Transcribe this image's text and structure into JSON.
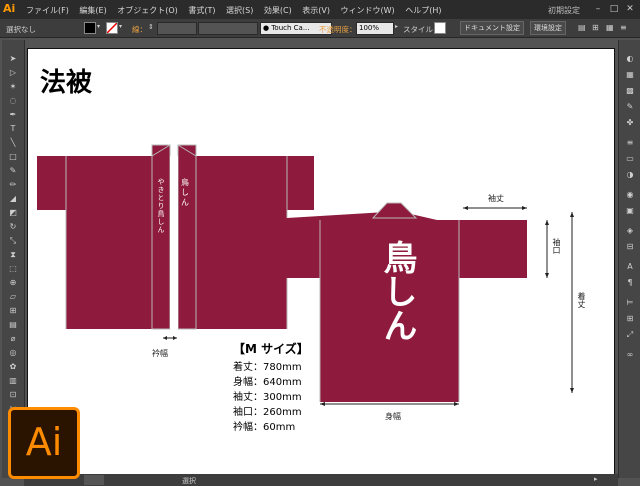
{
  "app": {
    "logo": "Ai",
    "menu": [
      "ファイル(F)",
      "編集(E)",
      "オブジェクト(O)",
      "書式(T)",
      "選択(S)",
      "効果(C)",
      "表示(V)",
      "ウィンドウ(W)",
      "ヘルプ(H)"
    ],
    "workspace": "初期設定",
    "win_min": "–",
    "win_max": "□",
    "win_close": "✕"
  },
  "control": {
    "selection": "選択なし",
    "stroke_label": "線：",
    "brush": "Touch Ca...",
    "opacity_label": "不透明度：",
    "opacity_value": "100%",
    "style_label": "スタイル：",
    "doc_settings": "ドキュメント設定",
    "env_settings": "環境設定"
  },
  "status": {
    "mode": "選択"
  },
  "artboard": {
    "heading": "法被",
    "logo_text": "Ai",
    "colors": {
      "garment": "#8e1a3d",
      "seam": "#b8b8b8",
      "collar_front": "#ffffff"
    },
    "calligraphy": "鳥しん",
    "collar_text_left": "鳥しん",
    "collar_text_right": "やきとり鳥しん",
    "labels": {
      "collar_width": "衿幅",
      "sleeve_length": "袖丈",
      "cuff": "袖口",
      "total_length": "着丈",
      "body_width": "身幅"
    },
    "size_title": "【M サイズ】",
    "sizes": [
      "着丈：780mm",
      "身幅：640mm",
      "袖丈：300mm",
      "袖口：260mm",
      "衿幅：60mm"
    ]
  }
}
